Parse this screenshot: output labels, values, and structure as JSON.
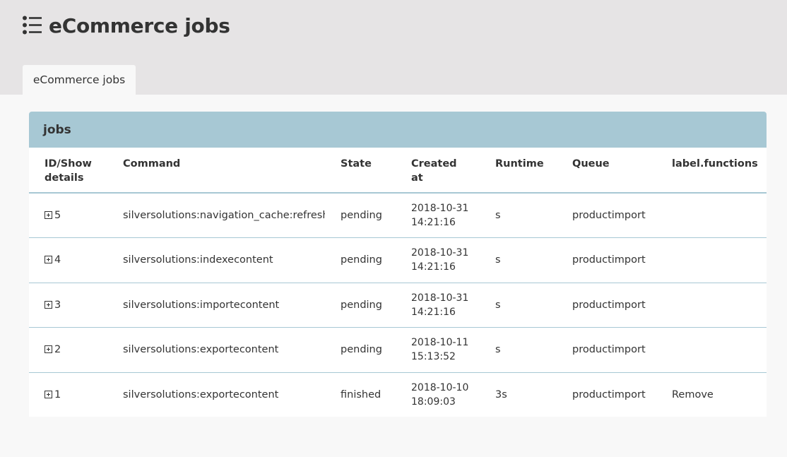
{
  "page": {
    "title": "eCommerce jobs"
  },
  "tabs": [
    {
      "label": "eCommerce jobs",
      "active": true
    }
  ],
  "panel": {
    "title": "jobs"
  },
  "table": {
    "headers": {
      "id": "ID/Show details",
      "command": "Command",
      "state": "State",
      "created": "Created at",
      "runtime": "Runtime",
      "queue": "Queue",
      "functions": "label.functions"
    },
    "rows": [
      {
        "id": "5",
        "command": "silversolutions:navigation_cache:refresh",
        "state": "pending",
        "created_date": "2018-10-31",
        "created_time": "14:21:16",
        "runtime": "s",
        "queue": "productimport",
        "functions": ""
      },
      {
        "id": "4",
        "command": "silversolutions:indexecontent",
        "state": "pending",
        "created_date": "2018-10-31",
        "created_time": "14:21:16",
        "runtime": "s",
        "queue": "productimport",
        "functions": ""
      },
      {
        "id": "3",
        "command": "silversolutions:importecontent",
        "state": "pending",
        "created_date": "2018-10-31",
        "created_time": "14:21:16",
        "runtime": "s",
        "queue": "productimport",
        "functions": ""
      },
      {
        "id": "2",
        "command": "silversolutions:exportecontent",
        "state": "pending",
        "created_date": "2018-10-11",
        "created_time": "15:13:52",
        "runtime": "s",
        "queue": "productimport",
        "functions": ""
      },
      {
        "id": "1",
        "command": "silversolutions:exportecontent",
        "state": "finished",
        "created_date": "2018-10-10",
        "created_time": "18:09:03",
        "runtime": "3s",
        "queue": "productimport",
        "functions": "Remove"
      }
    ]
  },
  "colors": {
    "header_bg": "#e6e4e5",
    "page_bg": "#f8f8f8",
    "panel_head_bg": "#a7c8d4",
    "text": "#333333"
  },
  "icons": {
    "title_icon": "list-icon",
    "row_expand_icon": "plus-square-icon"
  }
}
